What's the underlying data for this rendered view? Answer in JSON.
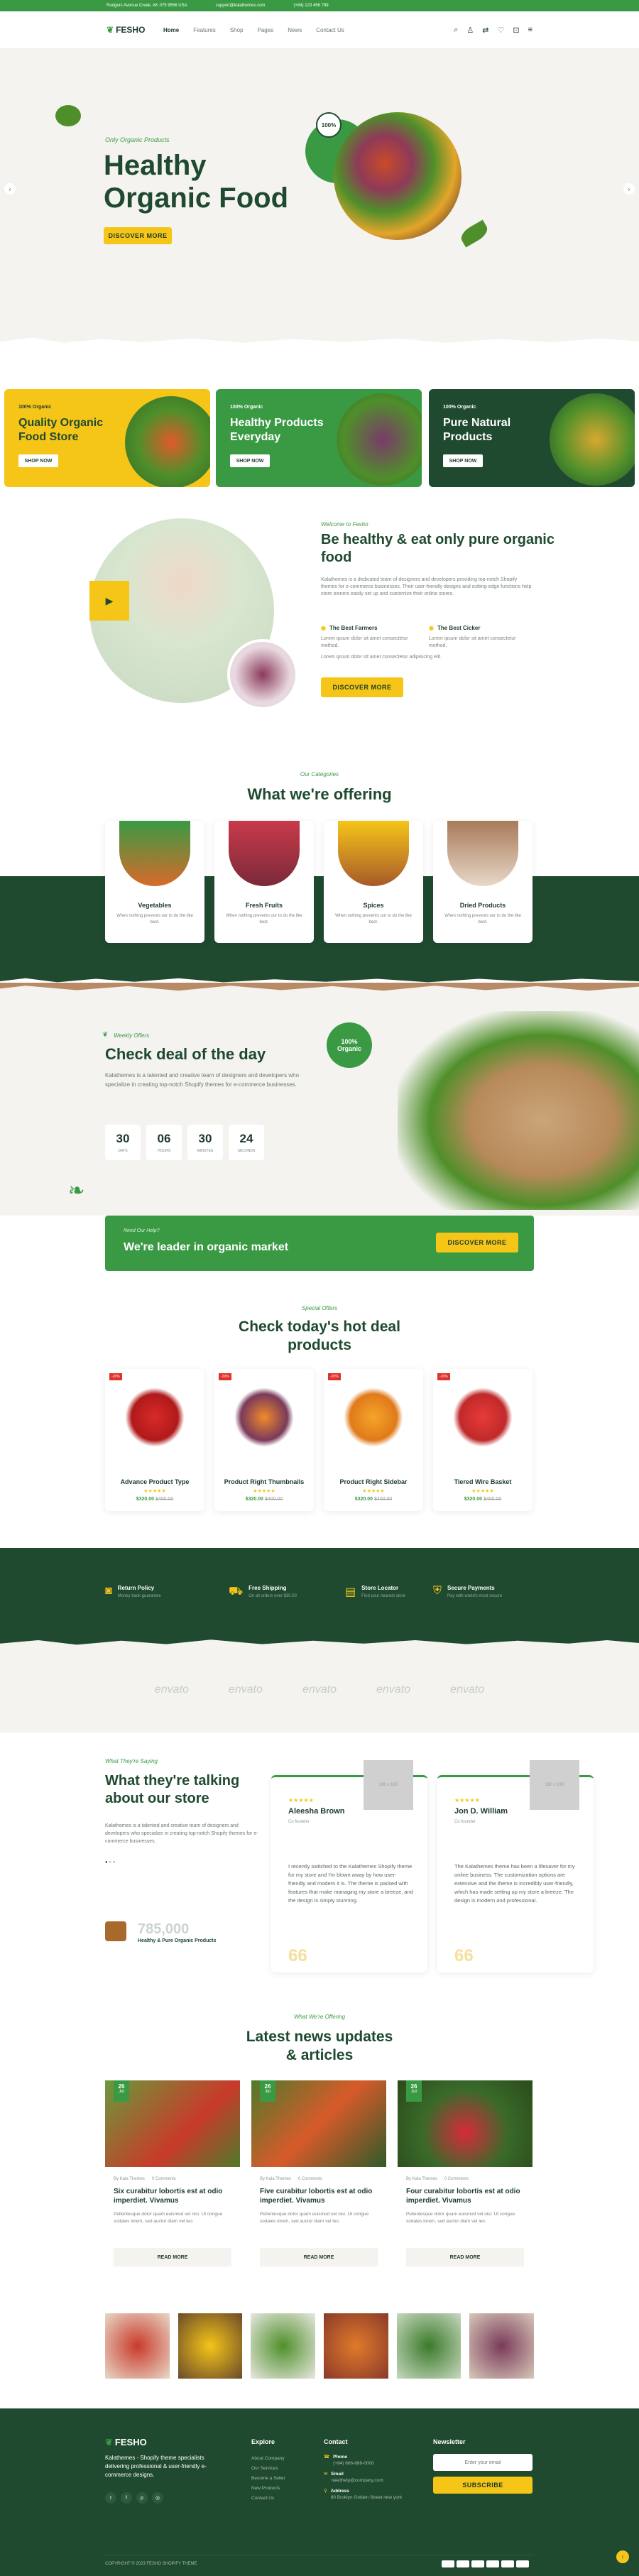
{
  "topbar": {
    "address": "Rudgers Avenue Creek, AK 075 9556 USA",
    "email": "support@kalathemes.com",
    "phone": "(+84) 123 456 789"
  },
  "nav": {
    "logo": "FESHO",
    "items": [
      "Home",
      "Features",
      "Shop",
      "Pages",
      "News",
      "Contact Us"
    ],
    "cart_count": "0",
    "wish_count": "0",
    "compare_count": "0"
  },
  "hero": {
    "eyebrow": "Only Organic Products",
    "title1": "Healthy",
    "title2": "Organic Food",
    "button": "DISCOVER MORE",
    "badge": "100%"
  },
  "promos": [
    {
      "tag": "100% Organic",
      "title": "Quality Organic Food Store",
      "button": "SHOP NOW",
      "bg": "#f5c518"
    },
    {
      "tag": "100% Organic",
      "title": "Healthy Products Everyday",
      "button": "SHOP NOW",
      "bg": "#3a9a44"
    },
    {
      "tag": "100% Organic",
      "title": "Pure Natural Products",
      "button": "SHOP NOW",
      "bg": "#1f4a30"
    }
  ],
  "about": {
    "eyebrow": "Welcome to Fesho",
    "title": "Be healthy & eat only pure organic food",
    "body": "Kalathemes is a dedicated team of designers and developers providing top-notch Shopify themes for e-commerce businesses. Their user-friendly designs and cutting-edge functions help store owners easily set up and customize their online stores.",
    "f1_title": "The Best Farmers",
    "f1_body": "Lorem ipsum dolor sit amet consectetur method.",
    "f2_title": "The Best Cicker",
    "f2_body": "Lorem ipsum dolor sit amet consectetur method.",
    "quote": "Lorem ipsum dolor sit amet consectetur adipisicing elit.",
    "button": "DISCOVER MORE"
  },
  "offering": {
    "eyebrow": "Our Categories",
    "title": "What we're offering",
    "items": [
      {
        "name": "Vegetables",
        "desc": "When nothing prevents our to do the like best."
      },
      {
        "name": "Fresh Fruits",
        "desc": "When nothing prevents our to do the like best."
      },
      {
        "name": "Spices",
        "desc": "When nothing prevents our to do the like best."
      },
      {
        "name": "Dried Products",
        "desc": "When nothing prevents our to do the like best."
      }
    ]
  },
  "deal": {
    "eyebrow": "Weekly Offers",
    "title": "Check deal of the day",
    "body": "Kalathemes is a talented and creative team of designers and developers who specialize in creating top-notch Shopify themes for e-commerce businesses.",
    "badge": "100% Organic",
    "timer": [
      {
        "v": "30",
        "l": "DAYS"
      },
      {
        "v": "06",
        "l": "HOURS"
      },
      {
        "v": "30",
        "l": "MINUTES"
      },
      {
        "v": "24",
        "l": "SECONDS"
      }
    ]
  },
  "leader": {
    "eyebrow": "Need Our Help?",
    "title": "We're leader in organic market",
    "button": "DISCOVER MORE"
  },
  "hotdeal": {
    "eyebrow": "Special Offers",
    "title1": "Check today's hot deal",
    "title2": "products",
    "items": [
      {
        "name": "Advance Product Type",
        "price": "$320.00",
        "old": "$400.00",
        "sale": "-20%"
      },
      {
        "name": "Product Right Thumbnails",
        "price": "$320.00",
        "old": "$400.00",
        "sale": "-20%"
      },
      {
        "name": "Product Right Sidebar",
        "price": "$320.00",
        "old": "$400.00",
        "sale": "-20%"
      },
      {
        "name": "Tiered Wire Basket",
        "price": "$320.00",
        "old": "$400.00",
        "sale": "-20%"
      }
    ]
  },
  "features": [
    {
      "title": "Return Policy",
      "desc": "Money back guarantee"
    },
    {
      "title": "Free Shipping",
      "desc": "On all orders over $30.00"
    },
    {
      "title": "Store Locator",
      "desc": "Find your nearest store"
    },
    {
      "title": "Secure Payments",
      "desc": "Pay with world's most secure"
    }
  ],
  "brands": [
    "envato",
    "envato",
    "envato",
    "envato",
    "envato"
  ],
  "testimonial": {
    "eyebrow": "What They're Saying",
    "title": "What they're talking about our store",
    "body": "Kalathemes is a talented and creative team of designers and developers who specialize in creating top-notch Shopify themes for e-commerce businesses.",
    "count": "785,000",
    "count_label": "Healthy & Pure Organic Products",
    "reviews": [
      {
        "name": "Aleesha Brown",
        "role": "Co founder",
        "text": "I recently switched to the Kalathemes Shopify theme for my store and I'm blown away by how user-friendly and modern it is. The theme is packed with features that make managing my store a breeze, and the design is simply stunning.",
        "img": "190 x 190"
      },
      {
        "name": "Jon D. William",
        "role": "Co founder",
        "text": "The Kalathemes theme has been a lifesaver for my online business. The customization options are extensive and the theme is incredibly user-friendly, which has made setting up my store a breeze. The design is modern and professional.",
        "img": "190 x 190"
      }
    ]
  },
  "news": {
    "eyebrow": "What We're Offering",
    "title1": "Latest news updates",
    "title2": "& articles",
    "items": [
      {
        "day": "26",
        "mon": "Jul",
        "by": "By Kala Themes",
        "comments": "0 Comments",
        "title": "Six curabitur lobortis est at odio imperdiet. Vivamus",
        "body": "Pellentesque dolor quam euismod vel nisi. Ut congue sodales lorem, sed auctor diam vel leo.",
        "button": "READ MORE"
      },
      {
        "day": "26",
        "mon": "Jul",
        "by": "By Kala Themes",
        "comments": "0 Comments",
        "title": "Five curabitur lobortis est at odio imperdiet. Vivamus",
        "body": "Pellentesque dolor quam euismod vel nisi. Ut congue sodales lorem, sed auctor diam vel leo.",
        "button": "READ MORE"
      },
      {
        "day": "26",
        "mon": "Jul",
        "by": "By Kala Themes",
        "comments": "0 Comments",
        "title": "Four curabitur lobortis est at odio imperdiet. Vivamus",
        "body": "Pellentesque dolor quam euismod vel nisi. Ut congue sodales lorem, sed auctor diam vel leo.",
        "button": "READ MORE"
      }
    ]
  },
  "footer": {
    "logo": "FESHO",
    "about": "Kalathemes - Shopify theme specialists delivering professional & user-friendly e-commerce designs.",
    "explore_title": "Explore",
    "explore": [
      "About Company",
      "Our Services",
      "Become a Seller",
      "New Products",
      "Contact Us"
    ],
    "contact_title": "Contact",
    "phone_label": "Phone",
    "phone": "(+84) 666-888-0000",
    "email_label": "Email",
    "email": "needhelp@company.com",
    "addr_label": "Address",
    "addr": "80 Broklyn Golden Street new york",
    "news_title": "Newsletter",
    "news_placeholder": "Enter your email",
    "news_button": "SUBSCRIBE",
    "copyright": "COPYRIGHT © 2023 FESHO SHOPIFY THEME"
  }
}
